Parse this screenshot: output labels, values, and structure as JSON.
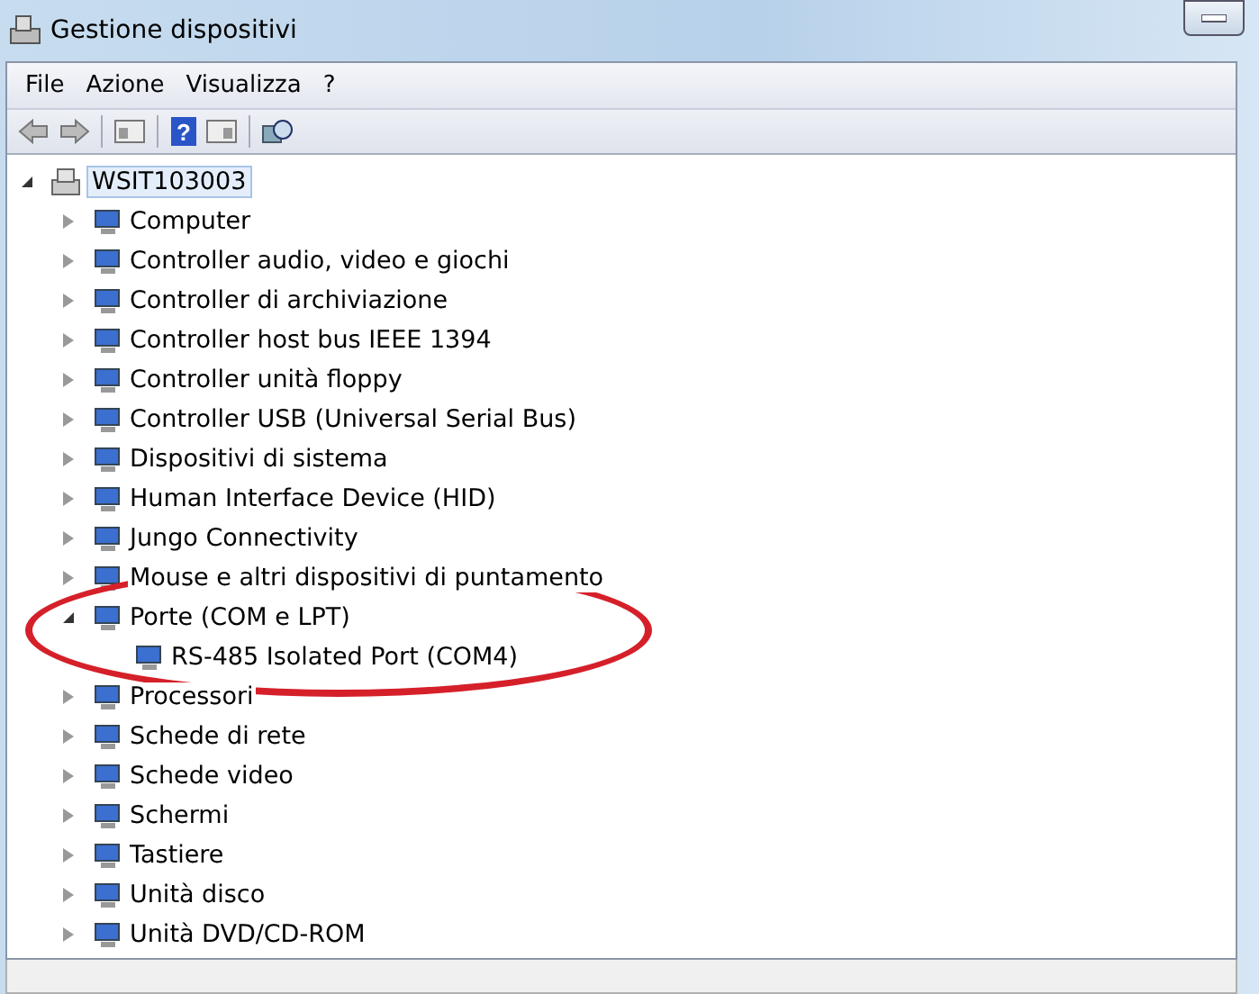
{
  "window": {
    "title": "Gestione dispositivi"
  },
  "menu": [
    "File",
    "Azione",
    "Visualizza",
    "?"
  ],
  "toolbar": {
    "help_glyph": "?"
  },
  "tree": [
    {
      "label": "WSIT103003",
      "expanded": true,
      "selected": true,
      "children": [
        {
          "label": "Computer",
          "expanded": false
        },
        {
          "label": "Controller audio, video e giochi",
          "expanded": false
        },
        {
          "label": "Controller di archiviazione",
          "expanded": false
        },
        {
          "label": "Controller host bus IEEE 1394",
          "expanded": false
        },
        {
          "label": "Controller unità floppy",
          "expanded": false
        },
        {
          "label": "Controller USB (Universal Serial Bus)",
          "expanded": false
        },
        {
          "label": "Dispositivi di sistema",
          "expanded": false
        },
        {
          "label": "Human Interface Device (HID)",
          "expanded": false
        },
        {
          "label": "Jungo Connectivity",
          "expanded": false
        },
        {
          "label": "Mouse e altri dispositivi di puntamento",
          "expanded": false
        },
        {
          "label": "Porte (COM e LPT)",
          "expanded": true,
          "children": [
            {
              "label": "RS-485 Isolated Port (COM4)"
            }
          ]
        },
        {
          "label": "Processori",
          "expanded": false
        },
        {
          "label": "Schede di rete",
          "expanded": false
        },
        {
          "label": "Schede video",
          "expanded": false
        },
        {
          "label": "Schermi",
          "expanded": false
        },
        {
          "label": "Tastiere",
          "expanded": false
        },
        {
          "label": "Unità disco",
          "expanded": false
        },
        {
          "label": "Unità DVD/CD-ROM",
          "expanded": false
        }
      ]
    }
  ]
}
